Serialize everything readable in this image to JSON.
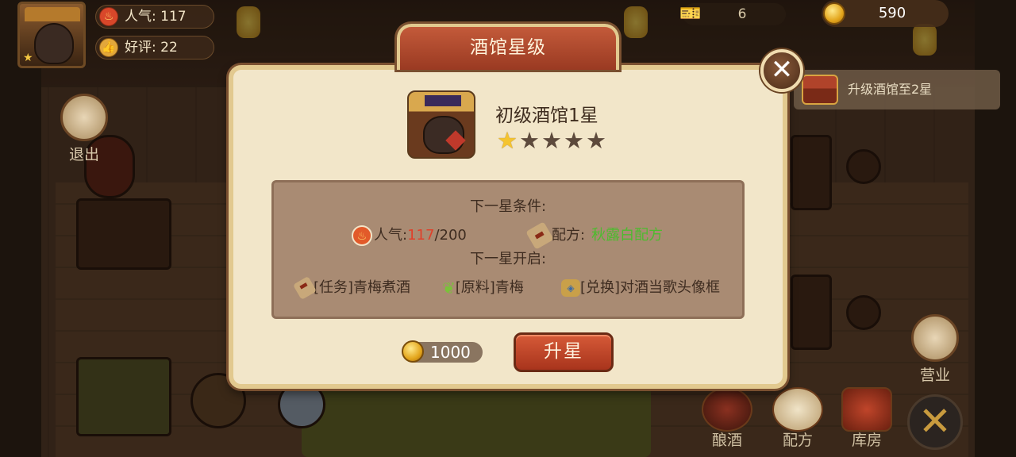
{
  "hud": {
    "popularity_label": "人气",
    "popularity_value": "117",
    "reviews_label": "好评",
    "reviews_value": "22",
    "ticket_count": "6",
    "coins": "590"
  },
  "quest": {
    "text": "升级酒馆至2星"
  },
  "side_buttons": {
    "exit": "退出",
    "open": "营业"
  },
  "bottom_nav": {
    "brew": "酿酒",
    "recipe": "配方",
    "storage": "库房"
  },
  "modal": {
    "title": "酒馆星级",
    "tavern_name": "初级酒馆1星",
    "stars_total": 5,
    "stars_filled": 1,
    "next_conditions_heading": "下一星条件:",
    "popularity_label": "人气:",
    "popularity_current": "117",
    "popularity_required": "/200",
    "recipe_label": "配方:",
    "recipe_value": "秋露白配方",
    "next_unlocks_heading": "下一星开启:",
    "unlocks": [
      "[任务]青梅煮酒",
      "[原料]青梅",
      "[兑换]对酒当歌头像框"
    ],
    "cost": "1000",
    "upgrade_button": "升星"
  },
  "colors": {
    "accent_red": "#c35a3a",
    "highlight_red": "#e0402a",
    "highlight_green": "#4dbb2e",
    "panel_cream": "#f2e6c9"
  },
  "icons": {
    "close": "close-icon",
    "coin": "coin-icon",
    "star": "star-icon",
    "popularity": "flame-icon",
    "recipe": "scroll-icon"
  }
}
